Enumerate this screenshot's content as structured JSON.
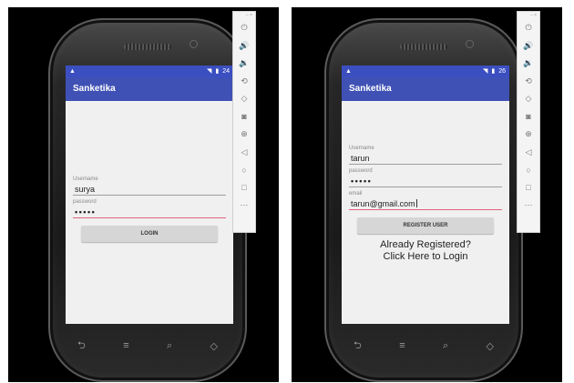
{
  "left": {
    "status_time": "24",
    "app_title": "Sanketika",
    "username_label": "Username",
    "username_value": "surya",
    "password_label": "password",
    "password_value": "•••••",
    "login_button": "LOGIN"
  },
  "right": {
    "status_time": "26",
    "app_title": "Sanketika",
    "username_label": "Username",
    "username_value": "tarun",
    "password_label": "password",
    "password_value": "•••••",
    "email_label": "email",
    "email_value": "tarun@gmail.com",
    "register_button": "REGISTER USER",
    "link_line1": "Already Registered?",
    "link_line2": "Click Here to Login"
  },
  "nav_glyphs": {
    "back": "⮌",
    "home": "≡",
    "search": "⌕",
    "recent": "◇"
  },
  "toolbar_glyphs": {
    "window_controls": "– ×",
    "items": [
      {
        "name": "power-icon",
        "glyph": "⏻"
      },
      {
        "name": "volume-up-icon",
        "glyph": "🔊"
      },
      {
        "name": "volume-down-icon",
        "glyph": "🔉"
      },
      {
        "name": "rotate-left-icon",
        "glyph": "⟲"
      },
      {
        "name": "rotate-right-icon",
        "glyph": "◇"
      },
      {
        "name": "camera-icon",
        "glyph": "◙"
      },
      {
        "name": "zoom-icon",
        "glyph": "⊕"
      },
      {
        "name": "back-icon",
        "glyph": "◁"
      },
      {
        "name": "home-icon",
        "glyph": "○"
      },
      {
        "name": "overview-icon",
        "glyph": "□"
      },
      {
        "name": "more-icon",
        "glyph": "⋯"
      }
    ]
  },
  "colors": {
    "status_bar": "#3b4fc1",
    "app_bar": "#3f51b5",
    "focus_underline": "#e0607e"
  }
}
